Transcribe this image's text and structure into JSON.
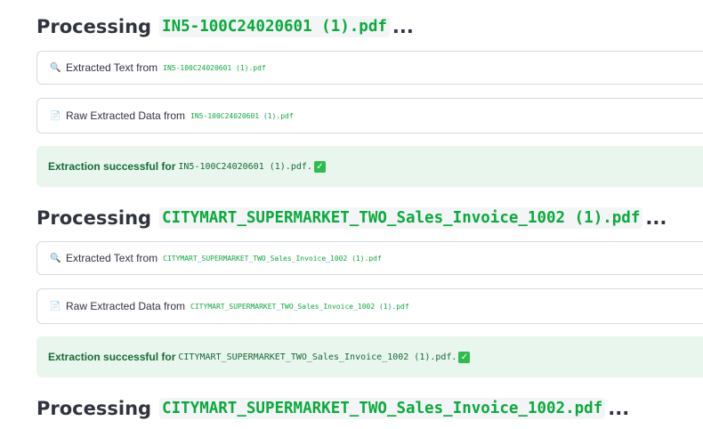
{
  "processing_label": "Processing",
  "ellipsis": "...",
  "extracted_text_label": "Extracted Text from",
  "raw_data_label": "Raw Extracted Data from",
  "success_label": "Extraction successful for",
  "success_icon": "✓",
  "search_icon": "🔍",
  "doc_icon": "📄",
  "files": [
    {
      "heading_name": "IN5-100C24020601 (1).pdf",
      "small_name": "IN5-100C24020601 (1).pdf",
      "success_name": "IN5-100C24020601 (1).pdf."
    },
    {
      "heading_name": "CITYMART_SUPERMARKET_TWO_Sales_Invoice_1002 (1).pdf",
      "small_name": "CITYMART_SUPERMARKET_TWO_Sales_Invoice_1002 (1).pdf",
      "success_name": "CITYMART_SUPERMARKET_TWO_Sales_Invoice_1002 (1).pdf."
    },
    {
      "heading_name": "CITYMART_SUPERMARKET_TWO_Sales_Invoice_1002.pdf"
    }
  ]
}
